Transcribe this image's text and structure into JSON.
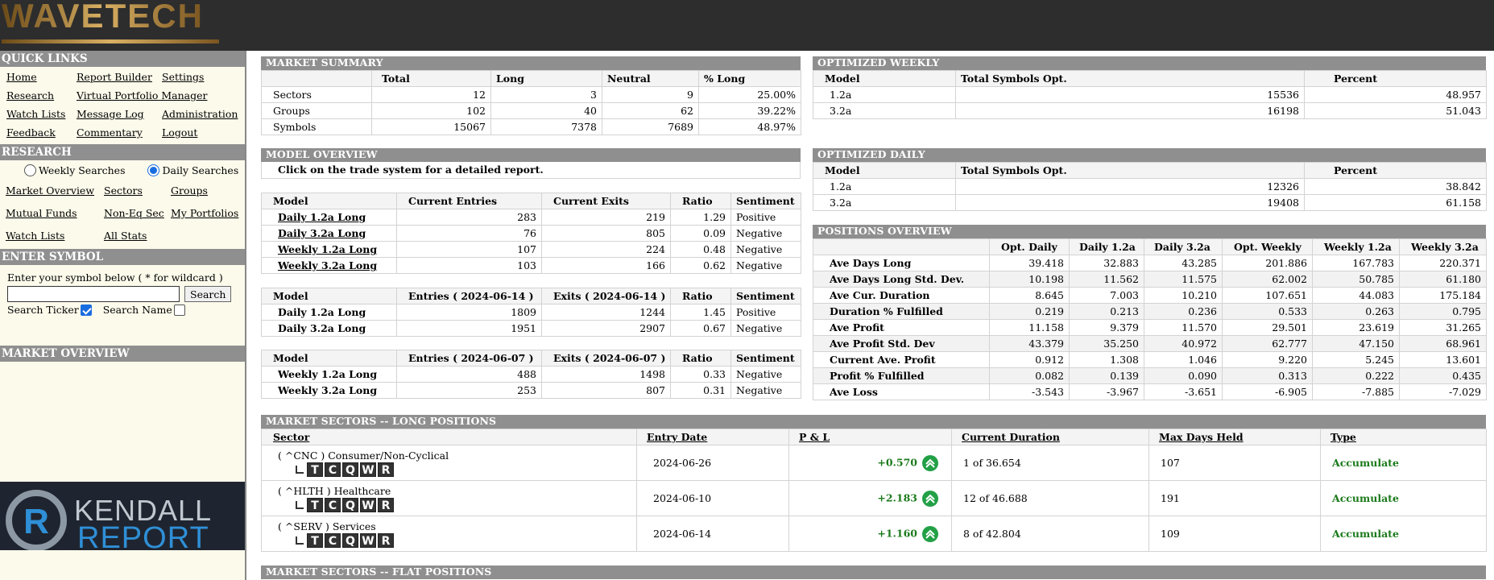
{
  "header": {
    "logo_text": "WAVETECH"
  },
  "quick_links": {
    "title": "QUICK LINKS",
    "items": [
      "Home",
      "Report Builder",
      "Settings",
      "Research",
      "Virtual Portfolio Manager",
      "Watch Lists",
      "Message Log",
      "Administration",
      "Feedback",
      "Commentary",
      "Logout"
    ]
  },
  "research": {
    "title": "RESEARCH",
    "weekly_label": "Weekly Searches",
    "daily_label": "Daily Searches",
    "items": [
      "Market Overview",
      "Sectors",
      "Groups",
      "Mutual Funds",
      "Non-Eq Sec",
      "My Portfolios",
      "Watch Lists",
      "All Stats"
    ]
  },
  "enter_symbol": {
    "title": "ENTER SYMBOL",
    "instruction": "Enter your symbol below ( * for wildcard )",
    "button": "Search",
    "ticker_label": "Search Ticker",
    "name_label": "Search Name"
  },
  "left_market_overview": {
    "title": "MARKET OVERVIEW"
  },
  "kendall": {
    "line1": "KENDALL",
    "line2": "REPORT"
  },
  "market_summary": {
    "title": "MARKET SUMMARY",
    "headers": [
      "",
      "Total",
      "Long",
      "Neutral",
      "% Long"
    ],
    "rows": [
      [
        "Sectors",
        "12",
        "3",
        "9",
        "25.00%"
      ],
      [
        "Groups",
        "102",
        "40",
        "62",
        "39.22%"
      ],
      [
        "Symbols",
        "15067",
        "7378",
        "7689",
        "48.97%"
      ]
    ]
  },
  "model_overview": {
    "title": "MODEL OVERVIEW",
    "note": "Click on the trade system for a detailed report.",
    "t1_headers": [
      "Model",
      "Current Entries",
      "Current Exits",
      "Ratio",
      "Sentiment"
    ],
    "t1_rows": [
      [
        "Daily 1.2a Long",
        "283",
        "219",
        "1.29",
        "Positive"
      ],
      [
        "Daily 3.2a Long",
        "76",
        "805",
        "0.09",
        "Negative"
      ],
      [
        "Weekly 1.2a Long",
        "107",
        "224",
        "0.48",
        "Negative"
      ],
      [
        "Weekly 3.2a Long",
        "103",
        "166",
        "0.62",
        "Negative"
      ]
    ],
    "t2_headers": [
      "Model",
      "Entries ( 2024-06-14 )",
      "Exits ( 2024-06-14 )",
      "Ratio",
      "Sentiment"
    ],
    "t2_rows": [
      [
        "Daily 1.2a Long",
        "1809",
        "1244",
        "1.45",
        "Positive"
      ],
      [
        "Daily 3.2a Long",
        "1951",
        "2907",
        "0.67",
        "Negative"
      ]
    ],
    "t3_headers": [
      "Model",
      "Entries ( 2024-06-07 )",
      "Exits ( 2024-06-07 )",
      "Ratio",
      "Sentiment"
    ],
    "t3_rows": [
      [
        "Weekly 1.2a Long",
        "488",
        "1498",
        "0.33",
        "Negative"
      ],
      [
        "Weekly 3.2a Long",
        "253",
        "807",
        "0.31",
        "Negative"
      ]
    ]
  },
  "optimized_weekly": {
    "title": "OPTIMIZED WEEKLY",
    "headers": [
      "Model",
      "Total Symbols Opt.",
      "Percent"
    ],
    "rows": [
      [
        "1.2a",
        "15536",
        "48.957"
      ],
      [
        "3.2a",
        "16198",
        "51.043"
      ]
    ]
  },
  "optimized_daily": {
    "title": "OPTIMIZED DAILY",
    "headers": [
      "Model",
      "Total Symbols Opt.",
      "Percent"
    ],
    "rows": [
      [
        "1.2a",
        "12326",
        "38.842"
      ],
      [
        "3.2a",
        "19408",
        "61.158"
      ]
    ]
  },
  "positions_overview": {
    "title": "POSITIONS OVERVIEW",
    "headers": [
      "",
      "Opt. Daily",
      "Daily 1.2a",
      "Daily 3.2a",
      "Opt. Weekly",
      "Weekly 1.2a",
      "Weekly 3.2a"
    ],
    "rows": [
      [
        "Ave Days Long",
        "39.418",
        "32.883",
        "43.285",
        "201.886",
        "167.783",
        "220.371"
      ],
      [
        "Ave Days Long Std. Dev.",
        "10.198",
        "11.562",
        "11.575",
        "62.002",
        "50.785",
        "61.180"
      ],
      [
        "Ave Cur. Duration",
        "8.645",
        "7.003",
        "10.210",
        "107.651",
        "44.083",
        "175.184"
      ],
      [
        "Duration % Fulfilled",
        "0.219",
        "0.213",
        "0.236",
        "0.533",
        "0.263",
        "0.795"
      ],
      [
        "Ave Profit",
        "11.158",
        "9.379",
        "11.570",
        "29.501",
        "23.619",
        "31.265"
      ],
      [
        "Ave Profit Std. Dev",
        "43.379",
        "35.250",
        "40.972",
        "62.777",
        "47.150",
        "68.961"
      ],
      [
        "Current Ave. Profit",
        "0.912",
        "1.308",
        "1.046",
        "9.220",
        "5.245",
        "13.601"
      ],
      [
        "Profit % Fulfilled",
        "0.082",
        "0.139",
        "0.090",
        "0.313",
        "0.222",
        "0.435"
      ],
      [
        "Ave Loss",
        "-3.543",
        "-3.967",
        "-3.651",
        "-6.905",
        "-7.885",
        "-7.029"
      ]
    ]
  },
  "sectors_long": {
    "title": "MARKET SECTORS -- LONG POSITIONS",
    "headers": [
      "Sector",
      "Entry Date",
      "P & L",
      "Current Duration",
      "Max Days Held",
      "Type"
    ],
    "tcqwr": [
      "T",
      "C",
      "Q",
      "W",
      "R"
    ],
    "rows": [
      {
        "sector": "( ^CNC ) Consumer/Non-Cyclical",
        "date": "2024-06-26",
        "pl": "+0.570",
        "duration": "1 of 36.654",
        "max": "107",
        "type": "Accumulate"
      },
      {
        "sector": "( ^HLTH ) Healthcare",
        "date": "2024-06-10",
        "pl": "+2.183",
        "duration": "12 of 46.688",
        "max": "191",
        "type": "Accumulate"
      },
      {
        "sector": "( ^SERV ) Services",
        "date": "2024-06-14",
        "pl": "+1.160",
        "duration": "8 of 42.804",
        "max": "109",
        "type": "Accumulate"
      }
    ]
  },
  "sectors_flat": {
    "title": "MARKET SECTORS -- FLAT POSITIONS"
  },
  "colors": {
    "header_bg": "#2d2d2d",
    "section_bg": "#8f8f8f",
    "panel_bg": "#fcfaeb",
    "positive": "#1b7a1b",
    "arrow_icon": "#22a046"
  }
}
